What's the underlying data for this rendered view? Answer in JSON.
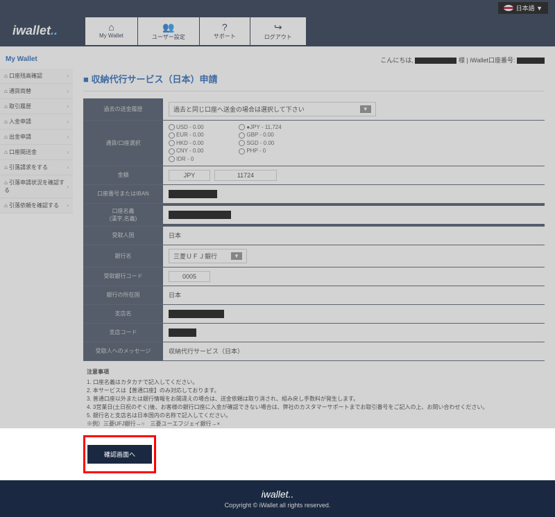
{
  "lang": "日本語 ▼",
  "logo": "iwallet",
  "nav": [
    {
      "icon": "⌂",
      "label": "My Wallet"
    },
    {
      "icon": "👥",
      "label": "ユーザー設定"
    },
    {
      "icon": "?",
      "label": "サポート"
    },
    {
      "icon": "↪",
      "label": "ログアウト"
    }
  ],
  "sidebar": {
    "title": "My Wallet",
    "items": [
      "口座残高確認",
      "通貨両替",
      "取引履歴",
      "入金申請",
      "出金申請",
      "口座間送金",
      "引落請求をする",
      "引落申請状況を確認する",
      "引落依頼を確認する"
    ]
  },
  "userbar": {
    "greeting": "こんにちは,",
    "suffix": "様  |  iWallet口座番号:"
  },
  "title": "■ 収納代行サービス（日本）申請",
  "form": {
    "past_label": "過去の送金履歴",
    "past_value": "過去と同じ口座へ送金の場合は選択して下さい",
    "currency_label": "通貨/口座選択",
    "currencies": [
      {
        "l": "USD - 0.00",
        "r": "●JPY - 11,724"
      },
      {
        "l": "EUR - 0.00",
        "r": "GBP - 0.00"
      },
      {
        "l": "HKD - 0.00",
        "r": "SGD - 0.00"
      },
      {
        "l": "CNY - 0.00",
        "r": "PHP - 0"
      },
      {
        "l": "IDR - 0",
        "r": ""
      }
    ],
    "amount_label": "金額",
    "amount_curr": "JPY",
    "amount_val": "11724",
    "iban_label": "口座番号またはIBAN",
    "name_label": "口座名義\n(漢字,名義)",
    "country_label": "受取人国",
    "country_val": "日本",
    "bank_label": "銀行名",
    "bank_val": "三菱ＵＦＪ銀行",
    "bankcode_label": "受取銀行コード",
    "bankcode_val": "0005",
    "bankcountry_label": "銀行の所在国",
    "bankcountry_val": "日本",
    "branch_label": "支店名",
    "branchcode_label": "支店コード",
    "msg_label": "受取人へのメッセージ",
    "msg_val": "収納代行サービス（日本）"
  },
  "notes": {
    "title": "注意事項",
    "items": [
      "1. 口座名義はカタカナで記入してください。",
      "2. 本サービスは【普通口座】のみ対応しております。",
      "3. 普通口座以外または銀行情報をお間違えの場合は、送金依頼は取り消され、組み戻し手数料が発生します。",
      "4. 3営業日(土日祝のぞく)後、お客様の銀行口座に入金が確認できない場合は、弊社のカスタマーサポートまでお取引番号をご記入の上、お問い合わせください。",
      "5. 銀行名と支店名は日本国内の名称で記入してください。",
      "   ※例）三菱UFJ銀行→○　三菱ユーエフジェイ銀行→×"
    ]
  },
  "confirm": "確認画面へ",
  "footer": {
    "logo": "iwallet..",
    "copy": "Copyright © iWallet all rights reserved."
  }
}
